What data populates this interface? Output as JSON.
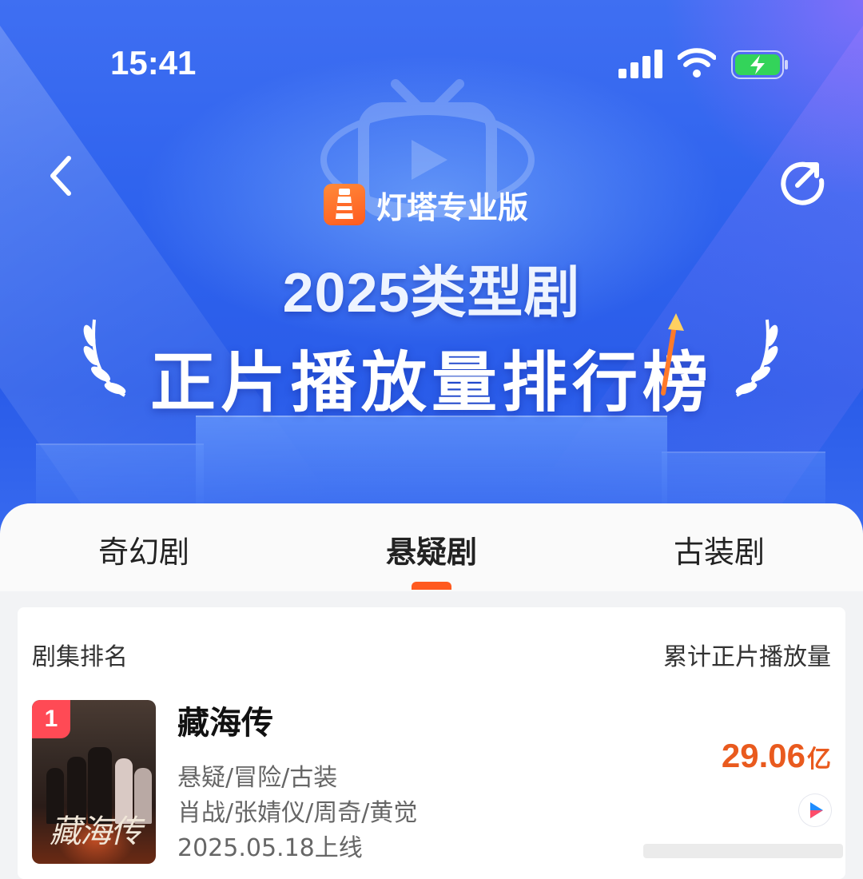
{
  "status_bar": {
    "time": "15:41"
  },
  "header": {
    "brand": "灯塔专业版",
    "title_line1": "2025类型剧",
    "title_line2": "正片播放量排行榜"
  },
  "tabs": [
    {
      "label": "奇幻剧",
      "active": false
    },
    {
      "label": "悬疑剧",
      "active": true
    },
    {
      "label": "古装剧",
      "active": false
    }
  ],
  "table": {
    "col_rank_label": "剧集排名",
    "col_plays_label": "累计正片播放量",
    "rows": [
      {
        "rank": "1",
        "poster_title": "藏海传",
        "title": "藏海传",
        "genres": "悬疑/冒险/古装",
        "cast": "肖战/张婧仪/周奇/黄觉",
        "release": "2025.05.18上线",
        "plays_value": "29.06",
        "plays_unit": "亿",
        "platform_icon": "youku-play-icon"
      }
    ]
  },
  "colors": {
    "accent": "#ff5a1f",
    "plays_text": "#e95a1e",
    "rank_badge": "#ff4a55",
    "hero_blue": "#2f63ee"
  }
}
